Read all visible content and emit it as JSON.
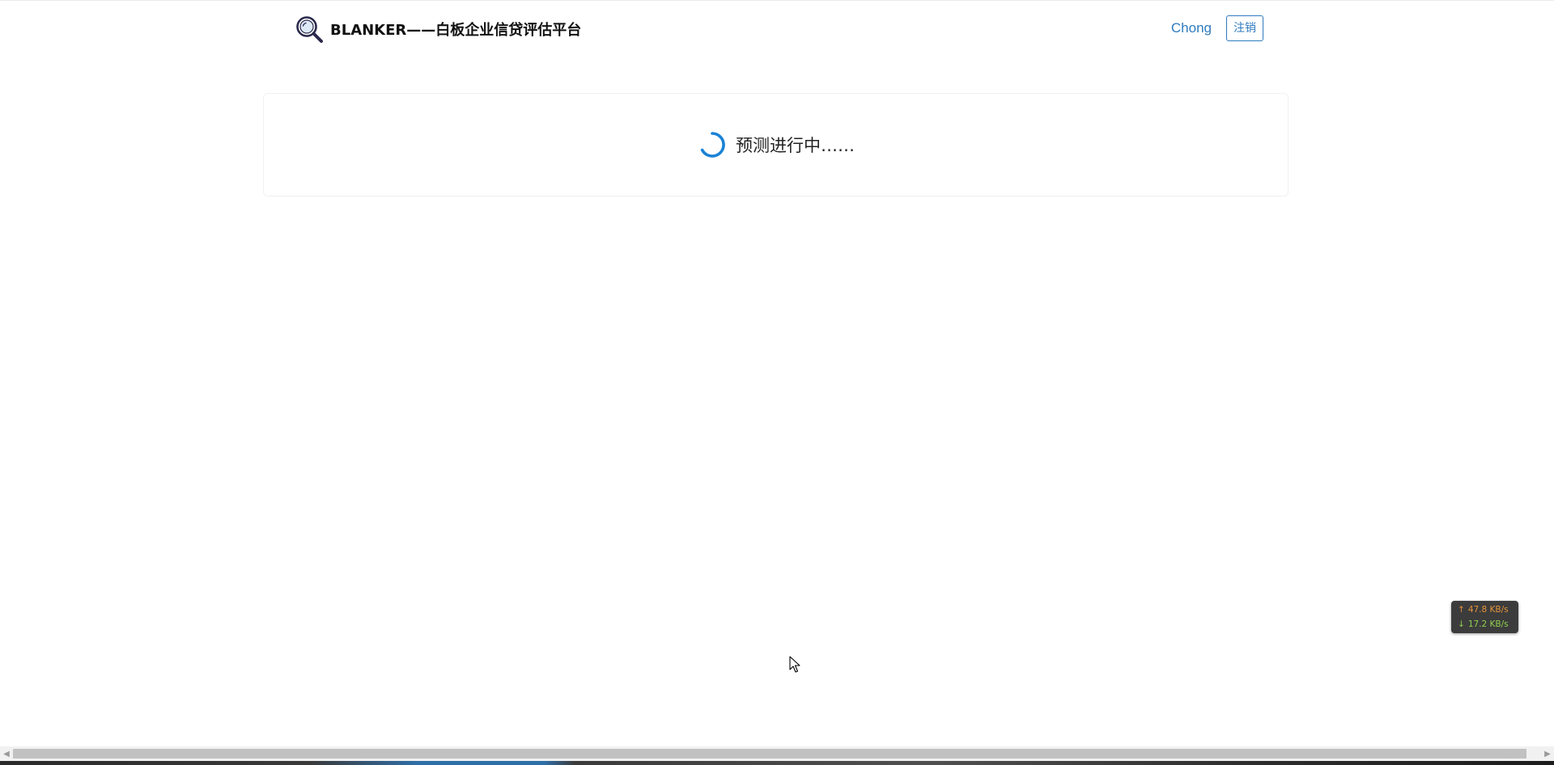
{
  "header": {
    "brand_title": "BLANKER——白板企业信贷评估平台",
    "logo_icon": "magnifier-logo-icon",
    "username": "Chong",
    "logout_label": "注销"
  },
  "status": {
    "text": "预测进行中……",
    "spinner_icon": "loading-spinner-icon"
  },
  "network_monitor": {
    "upload_speed": "47.8 KB/s",
    "download_speed": "17.2 KB/s",
    "upload_icon": "arrow-up-icon",
    "download_icon": "arrow-down-icon"
  },
  "colors": {
    "accent": "#2f7bbf",
    "spinner": "#1a82d6",
    "upload": "#e4933a",
    "download": "#8fcf4e"
  }
}
